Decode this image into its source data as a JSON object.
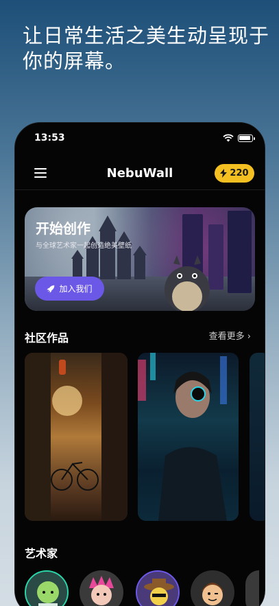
{
  "promo": {
    "headline": "让日常生活之美生动呈现于你的屏幕。"
  },
  "status_bar": {
    "time": "13:53"
  },
  "nav": {
    "title": "NebuWall",
    "coins": "220"
  },
  "hero": {
    "title": "开始创作",
    "subtitle": "与全球艺术家一起创造绝美壁纸",
    "button": "加入我们"
  },
  "community": {
    "title": "社区作品",
    "more": "查看更多"
  },
  "artists": {
    "title": "艺术家"
  },
  "colors": {
    "accent": "#6c58e6",
    "coin": "#f4c021",
    "background": "#050505"
  },
  "icons": [
    "menu-icon",
    "bolt-icon",
    "rocket-icon",
    "chevron-right-icon",
    "wifi-icon",
    "battery-icon"
  ]
}
